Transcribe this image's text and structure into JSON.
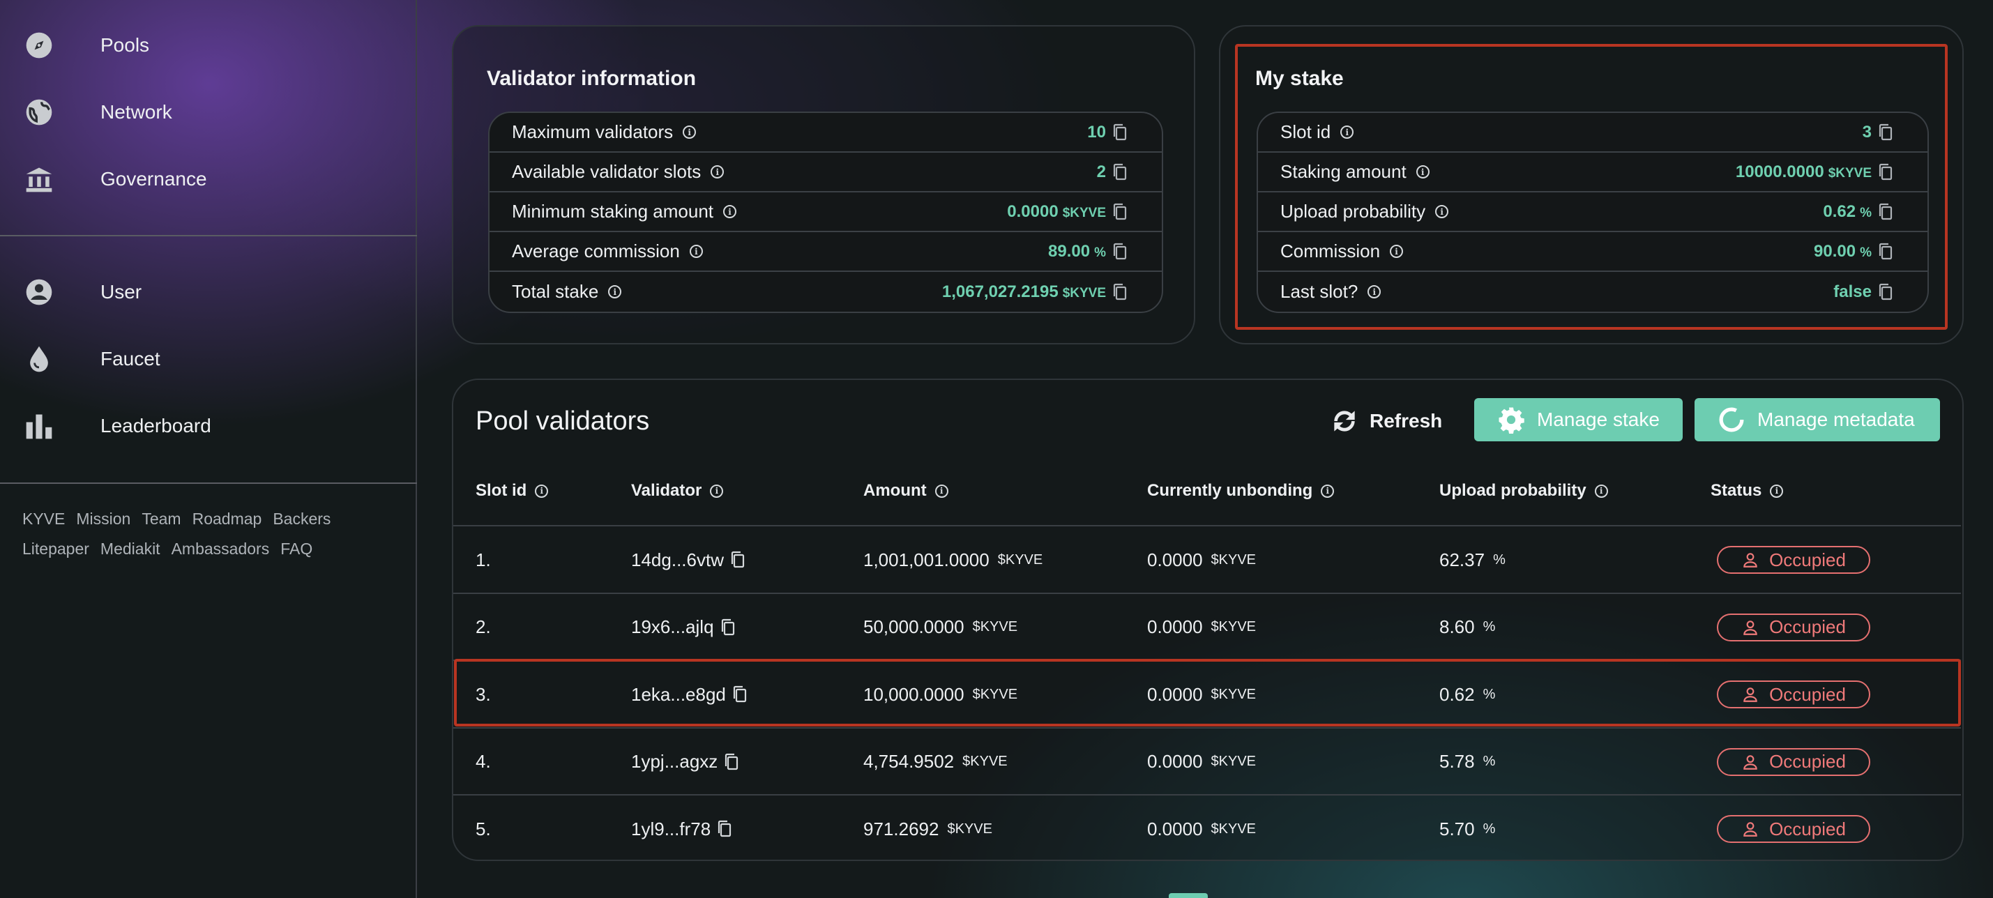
{
  "sidebar": {
    "nav_top": [
      {
        "label": "Pools",
        "icon": "compass-icon"
      },
      {
        "label": "Network",
        "icon": "globe-icon"
      },
      {
        "label": "Governance",
        "icon": "bank-icon"
      }
    ],
    "nav_bottom": [
      {
        "label": "User",
        "icon": "user-circle-icon"
      },
      {
        "label": "Faucet",
        "icon": "drop-icon"
      },
      {
        "label": "Leaderboard",
        "icon": "bar-chart-icon"
      }
    ],
    "footer_links_row1": [
      "KYVE",
      "Mission",
      "Team",
      "Roadmap",
      "Backers"
    ],
    "footer_links_row2": [
      "Litepaper",
      "Mediakit",
      "Ambassadors",
      "FAQ"
    ]
  },
  "validator_info": {
    "title": "Validator information",
    "rows": [
      {
        "label": "Maximum validators",
        "value": "10",
        "unit": ""
      },
      {
        "label": "Available validator slots",
        "value": "2",
        "unit": ""
      },
      {
        "label": "Minimum staking amount",
        "value": "0.0000",
        "unit": "$KYVE"
      },
      {
        "label": "Average commission",
        "value": "89.00",
        "unit": "%"
      },
      {
        "label": "Total stake",
        "value": "1,067,027.2195",
        "unit": "$KYVE"
      }
    ]
  },
  "my_stake": {
    "title": "My stake",
    "rows": [
      {
        "label": "Slot id",
        "value": "3",
        "unit": ""
      },
      {
        "label": "Staking amount",
        "value": "10000.0000",
        "unit": "$KYVE"
      },
      {
        "label": "Upload probability",
        "value": "0.62",
        "unit": "%"
      },
      {
        "label": "Commission",
        "value": "90.00",
        "unit": "%"
      },
      {
        "label": "Last slot?",
        "value": "false",
        "unit": ""
      }
    ]
  },
  "pool_validators": {
    "title": "Pool validators",
    "refresh_label": "Refresh",
    "manage_stake_label": "Manage stake",
    "manage_metadata_label": "Manage metadata",
    "columns": [
      "Slot id",
      "Validator",
      "Amount",
      "Currently unbonding",
      "Upload probability",
      "Status"
    ],
    "rows": [
      {
        "slot": "1.",
        "validator": "14dg...6vtw",
        "amount": "1,001,001.0000",
        "unbonding": "0.0000",
        "probability": "62.37",
        "status": "Occupied"
      },
      {
        "slot": "2.",
        "validator": "19x6...ajlq",
        "amount": "50,000.0000",
        "unbonding": "0.0000",
        "probability": "8.60",
        "status": "Occupied"
      },
      {
        "slot": "3.",
        "validator": "1eka...e8gd",
        "amount": "10,000.0000",
        "unbonding": "0.0000",
        "probability": "0.62",
        "status": "Occupied"
      },
      {
        "slot": "4.",
        "validator": "1ypj...agxz",
        "amount": "4,754.9502",
        "unbonding": "0.0000",
        "probability": "5.78",
        "status": "Occupied"
      },
      {
        "slot": "5.",
        "validator": "1yl9...fr78",
        "amount": "971.2692",
        "unbonding": "0.0000",
        "probability": "5.70",
        "status": "Occupied"
      }
    ],
    "currency_unit": "$KYVE",
    "percent_unit": "%"
  },
  "colors": {
    "accent": "#6dcdb1",
    "highlight": "#b83522",
    "status_occupied": "#f07a7a"
  }
}
